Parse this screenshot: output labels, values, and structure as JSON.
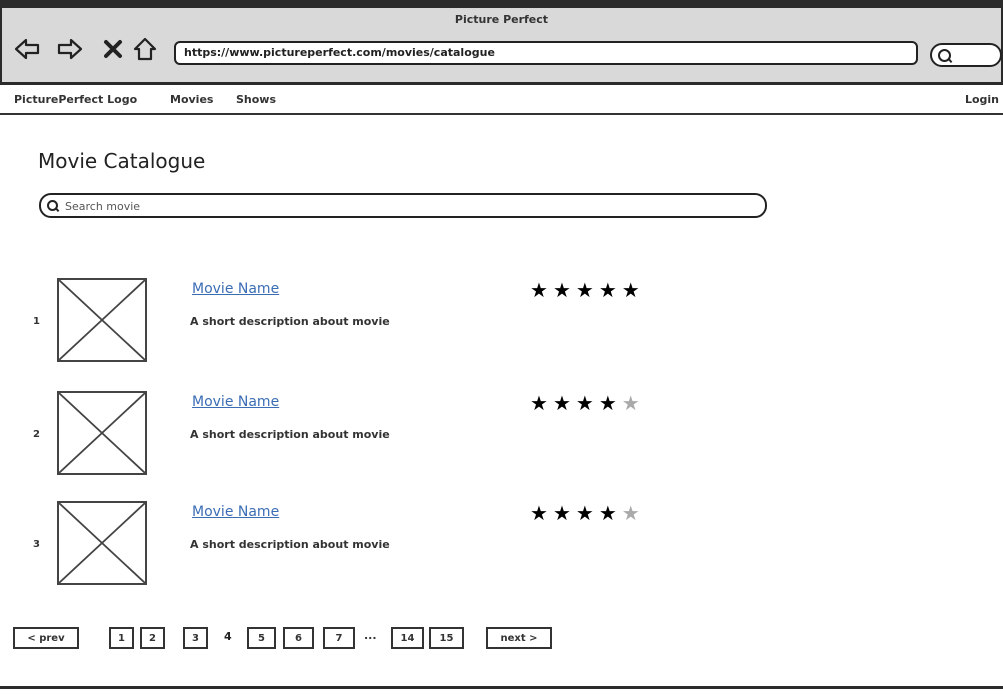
{
  "browser": {
    "window_title": "Picture Perfect",
    "url": "https://www.pictureperfect.com/movies/catalogue",
    "icons": [
      "back-icon",
      "forward-icon",
      "stop-icon",
      "home-icon",
      "search-icon"
    ]
  },
  "nav": {
    "logo": "PicturePerfect Logo",
    "movies": "Movies",
    "shows": "Shows",
    "login": "Login"
  },
  "page": {
    "title": "Movie Catalogue",
    "search_placeholder": "Search movie"
  },
  "movies": [
    {
      "rank": "1",
      "name": "Movie Name",
      "description": "A short description about movie",
      "rating": 5,
      "rating_max": 5
    },
    {
      "rank": "2",
      "name": "Movie Name",
      "description": "A short description about movie",
      "rating": 4,
      "rating_max": 5
    },
    {
      "rank": "3",
      "name": "Movie Name",
      "description": "A short description about movie",
      "rating": 4,
      "rating_max": 5
    }
  ],
  "pagination": {
    "prev": "< prev",
    "pages_before": [
      "1",
      "2",
      "3"
    ],
    "current": "4",
    "pages_after": [
      "5",
      "6",
      "7"
    ],
    "ellipsis": "...",
    "pages_end": [
      "14",
      "15"
    ],
    "next": "next >"
  },
  "colors": {
    "link": "#3b6db5",
    "chrome_bg": "#d9d9d9",
    "star_on": "#000000",
    "star_off": "#aaaaaa"
  }
}
